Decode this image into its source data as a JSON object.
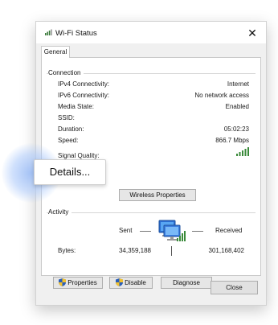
{
  "window": {
    "title": "Wi-Fi Status",
    "close_glyph": "✕"
  },
  "tabs": {
    "general": "General"
  },
  "connection": {
    "label": "Connection",
    "rows": [
      {
        "key": "IPv4 Connectivity:",
        "value": "Internet"
      },
      {
        "key": "IPv6 Connectivity:",
        "value": "No network access"
      },
      {
        "key": "Media State:",
        "value": "Enabled"
      },
      {
        "key": "SSID:",
        "value": ""
      },
      {
        "key": "Duration:",
        "value": "05:02:23"
      },
      {
        "key": "Speed:",
        "value": "866.7 Mbps"
      }
    ],
    "signal_label": "Signal Quality:",
    "signal_bars": 5
  },
  "buttons": {
    "details": "Details...",
    "wireless_properties": "Wireless Properties",
    "properties": "Properties",
    "disable": "Disable",
    "diagnose": "Diagnose",
    "close": "Close"
  },
  "activity": {
    "label": "Activity",
    "sent_label": "Sent",
    "received_label": "Received",
    "bytes_label": "Bytes:",
    "bytes_sent": "34,359,188",
    "bytes_received": "301,168,402"
  },
  "colors": {
    "accent": "#3a8a3a",
    "shield_blue": "#2b5fb8",
    "shield_yellow": "#f2c12e"
  },
  "icons": [
    "wifi-signal-icon",
    "close-icon",
    "network-computers-icon",
    "shield-icon"
  ]
}
